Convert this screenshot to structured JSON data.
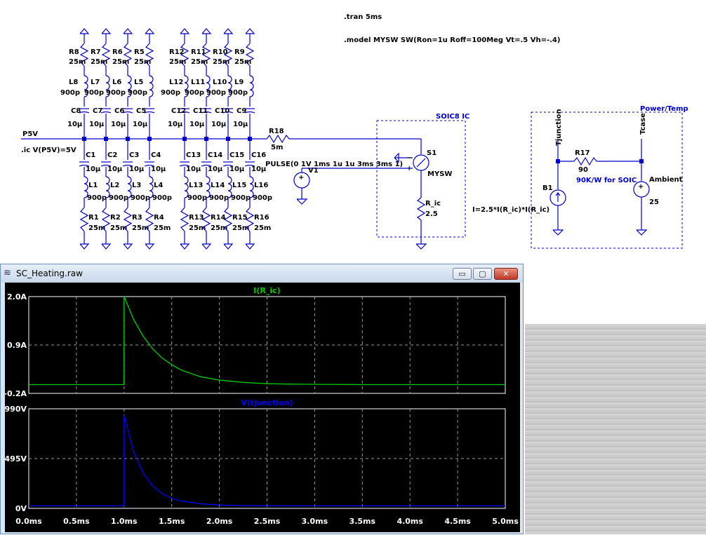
{
  "schematic": {
    "directives": {
      "tran": ".tran 5ms",
      "model": ".model MYSW SW(Ron=1u Roff=100Meg Vt=.5 Vh=-.4)",
      "ic": ".ic V(P5V)=5V"
    },
    "net_p5v": "P5V",
    "top_rows": {
      "r_names": [
        "R8",
        "R7",
        "R6",
        "R5",
        "R12",
        "R11",
        "R10",
        "R9"
      ],
      "r_values": [
        "25m",
        "25m",
        "25m",
        "25m",
        "25m",
        "25m",
        "25m",
        "25m"
      ],
      "l_names": [
        "L8",
        "L7",
        "L6",
        "L5",
        "L12",
        "L11",
        "L10",
        "L9"
      ],
      "l_values": [
        "900p",
        "900p",
        "900p",
        "900p",
        "900p",
        "900p",
        "900p",
        "900p"
      ],
      "c_names": [
        "C8",
        "C7",
        "C6",
        "C5",
        "C12",
        "C11",
        "C10",
        "C9"
      ],
      "c_values": [
        "10µ",
        "10µ",
        "10µ",
        "10µ",
        "10µ",
        "10µ",
        "10µ",
        "10µ"
      ]
    },
    "bottom_rows": {
      "c_names": [
        "C1",
        "C2",
        "C3",
        "C4",
        "C13",
        "C14",
        "C15",
        "C16"
      ],
      "c_values": [
        "10µ",
        "10µ",
        "10µ",
        "10µ",
        "10µ",
        "10µ",
        "10µ",
        "10µ"
      ],
      "l_names": [
        "L1",
        "L2",
        "L3",
        "L4",
        "L13",
        "L14",
        "L15",
        "L16"
      ],
      "l_values": [
        "900p",
        "900p",
        "900p",
        "900p",
        "900p",
        "900p",
        "900p",
        "900p"
      ],
      "r_names": [
        "R1",
        "R2",
        "R3",
        "R4",
        "R13",
        "R14",
        "R15",
        "R16"
      ],
      "r_values": [
        "25m",
        "25m",
        "25m",
        "25m",
        "25m",
        "25m",
        "25m",
        "25m"
      ]
    },
    "r18": {
      "name": "R18",
      "value": "5m"
    },
    "soic_label": "SOIC8 IC",
    "switch": {
      "name": "S1",
      "model": "MYSW"
    },
    "v1": {
      "name": "V1",
      "value": "PULSE(0 1V 1ms 1u 1u 3ms 3ms 1)"
    },
    "r_ic": {
      "name": "R_ic",
      "value": "2.5"
    },
    "power_temp_label": "Power/Temp",
    "b1": {
      "name": "B1",
      "expr": "I=2.5*I(R_ic)*I(R_ic)"
    },
    "tjunction_label": "Tjunction",
    "tcase_label": "Tcase",
    "r17": {
      "name": "R17",
      "value": "90",
      "note": "90K/W for SOIC"
    },
    "ambient": {
      "name": "Ambient",
      "value": "25"
    }
  },
  "wave_window": {
    "title": "SC_Heating.raw",
    "buttons": {
      "minimize": "▭",
      "maximize": "▢",
      "close": "✕"
    }
  },
  "colors": {
    "wire": "#0000cc",
    "trace1": "#00cc00",
    "trace2": "#0000ff",
    "plot_bg": "#000000",
    "close_button": "#c0392b"
  },
  "chart_data": [
    {
      "type": "line",
      "title": "I(R_ic)",
      "ylabel": "",
      "xlabel": "",
      "ylim": [
        -0.2,
        2.0
      ],
      "xlim": [
        0,
        5
      ],
      "y_tick_labels": [
        "2.0A",
        "0.9A",
        "-0.2A"
      ],
      "y_ticks": [
        2.0,
        0.9,
        -0.2
      ],
      "grid": true,
      "series": [
        {
          "name": "I(R_ic)",
          "x": [
            0,
            0.999,
            1.0,
            1.1,
            1.2,
            1.3,
            1.4,
            1.5,
            1.6,
            1.8,
            2.0,
            2.25,
            2.5,
            2.75,
            3.0,
            3.5,
            4.0,
            5.0
          ],
          "values": [
            0,
            0,
            2.0,
            1.48,
            1.1,
            0.81,
            0.6,
            0.45,
            0.33,
            0.18,
            0.1,
            0.05,
            0.02,
            0.01,
            0.005,
            0,
            0,
            0
          ]
        }
      ]
    },
    {
      "type": "line",
      "title": "V(tjunction)",
      "ylabel": "",
      "xlabel": "",
      "ylim": [
        0,
        990
      ],
      "xlim": [
        0,
        5
      ],
      "y_tick_labels": [
        "990V",
        "495V",
        "0V"
      ],
      "y_ticks": [
        990,
        495,
        0
      ],
      "x_tick_labels": [
        "0.0ms",
        "0.5ms",
        "1.0ms",
        "1.5ms",
        "2.0ms",
        "2.5ms",
        "3.0ms",
        "3.5ms",
        "4.0ms",
        "4.5ms",
        "5.0ms"
      ],
      "x_ticks": [
        0,
        0.5,
        1.0,
        1.5,
        2.0,
        2.5,
        3.0,
        3.5,
        4.0,
        4.5,
        5.0
      ],
      "grid": true,
      "series": [
        {
          "name": "V(tjunction)",
          "x": [
            0,
            0.999,
            1.0,
            1.1,
            1.2,
            1.3,
            1.4,
            1.5,
            1.6,
            1.8,
            2.0,
            2.25,
            2.5,
            3.0,
            4.0,
            5.0
          ],
          "values": [
            25,
            25,
            925,
            560,
            350,
            220,
            145,
            100,
            72,
            45,
            33,
            28,
            26,
            25,
            25,
            25
          ]
        }
      ]
    }
  ]
}
